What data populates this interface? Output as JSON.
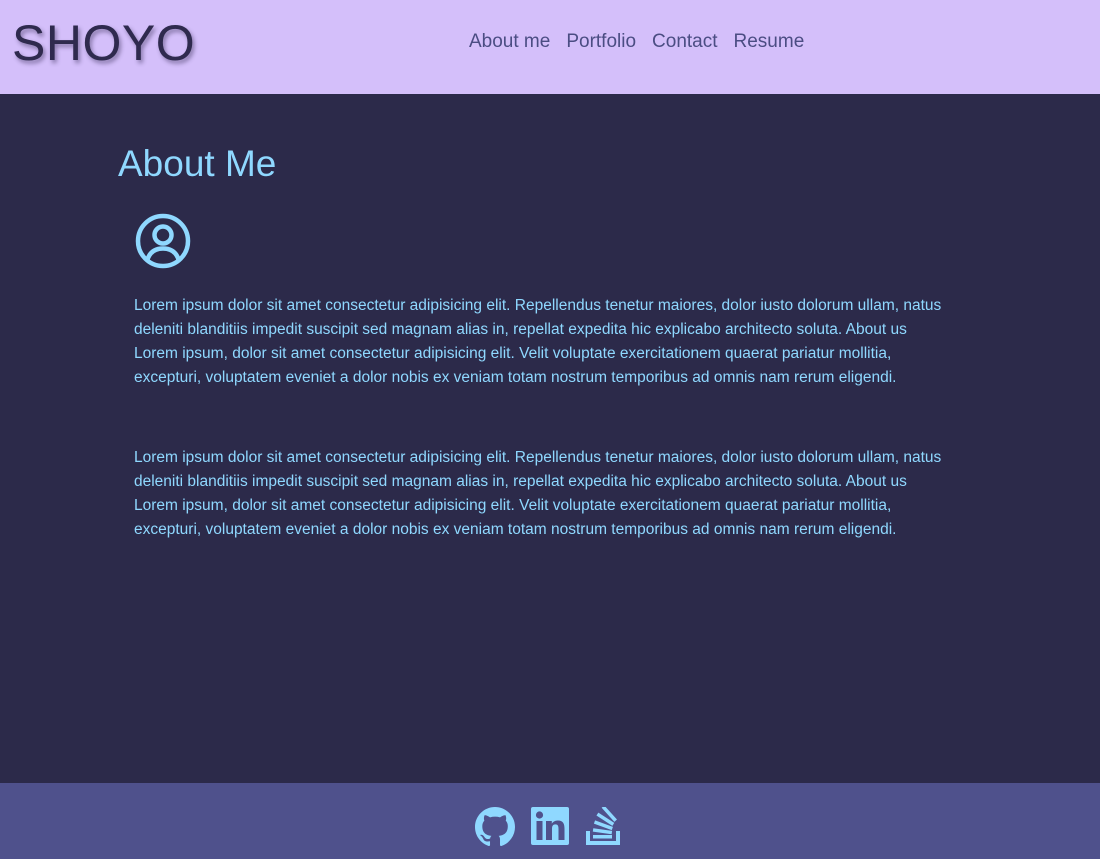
{
  "header": {
    "logo": "SHOYO",
    "nav": [
      {
        "label": "About me"
      },
      {
        "label": "Portfolio"
      },
      {
        "label": "Contact"
      },
      {
        "label": "Resume"
      }
    ]
  },
  "main": {
    "title": "About Me",
    "avatar_icon": "user-circle-icon",
    "paragraphs": [
      "Lorem ipsum dolor sit amet consectetur adipisicing elit. Repellendus tenetur maiores, dolor iusto dolorum ullam, natus deleniti blanditiis impedit suscipit sed magnam alias in, repellat expedita hic explicabo architecto soluta. About us Lorem ipsum, dolor sit amet consectetur adipisicing elit. Velit voluptate exercitationem quaerat pariatur mollitia, excepturi, voluptatem eveniet a dolor nobis ex veniam totam nostrum temporibus ad omnis nam rerum eligendi.",
      "Lorem ipsum dolor sit amet consectetur adipisicing elit. Repellendus tenetur maiores, dolor iusto dolorum ullam, natus deleniti blanditiis impedit suscipit sed magnam alias in, repellat expedita hic explicabo architecto soluta. About us Lorem ipsum, dolor sit amet consectetur adipisicing elit. Velit voluptate exercitationem quaerat pariatur mollitia, excepturi, voluptatem eveniet a dolor nobis ex veniam totam nostrum temporibus ad omnis nam rerum eligendi."
    ]
  },
  "footer": {
    "icons": [
      "github-icon",
      "linkedin-icon",
      "stack-overflow-icon"
    ]
  },
  "colors": {
    "header_bg": "#d4bffa",
    "logo": "#2f2a4e",
    "nav_text": "#4b4d83",
    "main_bg": "#2c2a4a",
    "accent_text": "#8fd8ff",
    "footer_bg": "#4f518c"
  }
}
